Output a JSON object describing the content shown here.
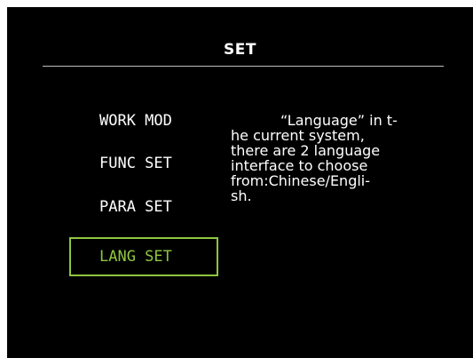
{
  "screen": {
    "title": "SET",
    "colors": {
      "background": "#000000",
      "text": "#ffffff",
      "accent": "#8fc63f",
      "divider": "#bfbfbf"
    }
  },
  "menu": {
    "items": [
      {
        "label": "WORK MOD",
        "selected": false
      },
      {
        "label": "FUNC SET",
        "selected": false
      },
      {
        "label": "PARA SET",
        "selected": false
      },
      {
        "label": "LANG SET",
        "selected": true
      }
    ]
  },
  "description": {
    "lines": [
      "“Language” in t-",
      "he current system,",
      "there are 2 language",
      "interface to choose",
      "from:Chinese/Engli-",
      "sh."
    ]
  }
}
